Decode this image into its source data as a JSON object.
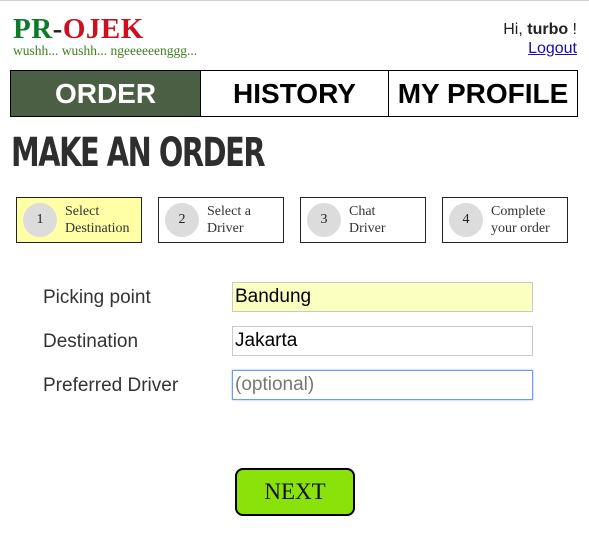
{
  "brand": {
    "logo_part1": "PR",
    "logo_dash": "-",
    "logo_part2": "OJEK",
    "tagline": "wushh... wushh... ngeeeeeenggg..."
  },
  "user": {
    "greeting": "Hi, ",
    "username": "turbo",
    "suffix": " !",
    "logout_label": "Logout"
  },
  "nav": {
    "tabs": [
      {
        "label": "ORDER",
        "active": true
      },
      {
        "label": "HISTORY",
        "active": false
      },
      {
        "label": "MY PROFILE",
        "active": false
      }
    ]
  },
  "page": {
    "title": "MAKE AN ORDER"
  },
  "steps": [
    {
      "number": "1",
      "label": "Select\nDestination",
      "active": true
    },
    {
      "number": "2",
      "label": "Select a\nDriver",
      "active": false
    },
    {
      "number": "3",
      "label": "Chat\nDriver",
      "active": false
    },
    {
      "number": "4",
      "label": "Complete\nyour order",
      "active": false
    }
  ],
  "form": {
    "picking_point": {
      "label": "Picking point",
      "value": "Bandung",
      "placeholder": ""
    },
    "destination": {
      "label": "Destination",
      "value": "Jakarta",
      "placeholder": ""
    },
    "preferred_driver": {
      "label": "Preferred Driver",
      "value": "",
      "placeholder": "(optional)"
    }
  },
  "actions": {
    "next_label": "NEXT"
  },
  "colors": {
    "nav_active_bg": "#4b5f45",
    "step_active_bg": "#ffffa6",
    "next_button_bg": "#8ae20a",
    "logo_green": "#0b7a2a",
    "logo_red": "#cc1020",
    "filled_input_bg": "#fbffc0"
  }
}
